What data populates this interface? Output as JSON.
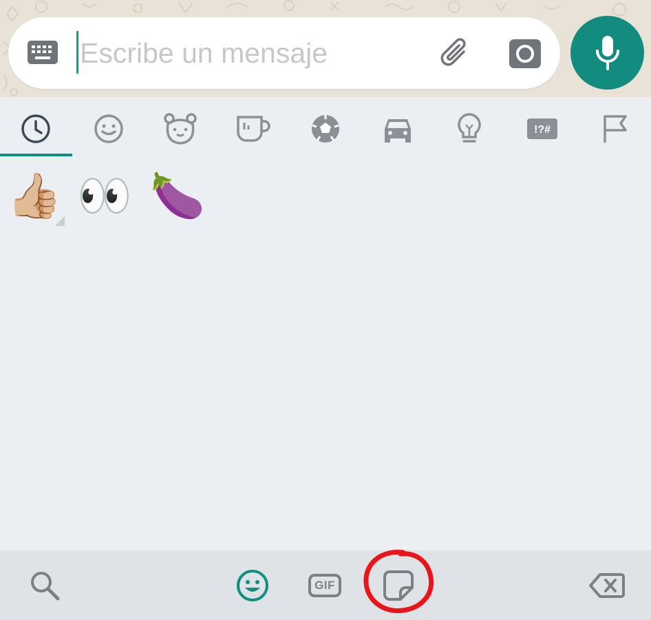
{
  "composer": {
    "placeholder": "Escribe un mensaje",
    "value": "",
    "keyboard_icon": "keyboard-icon",
    "attach_icon": "paperclip-icon",
    "camera_icon": "camera-icon",
    "mic_icon": "microphone-icon"
  },
  "categories": [
    {
      "name": "recent",
      "icon": "clock-icon",
      "selected": true
    },
    {
      "name": "smileys",
      "icon": "smiley-icon",
      "selected": false
    },
    {
      "name": "animals",
      "icon": "bear-icon",
      "selected": false
    },
    {
      "name": "food",
      "icon": "cup-icon",
      "selected": false
    },
    {
      "name": "activities",
      "icon": "soccer-ball-icon",
      "selected": false
    },
    {
      "name": "travel",
      "icon": "car-icon",
      "selected": false
    },
    {
      "name": "objects",
      "icon": "lightbulb-icon",
      "selected": false
    },
    {
      "name": "symbols",
      "icon": "symbols-icon",
      "label": "!?#",
      "selected": false
    },
    {
      "name": "flags",
      "icon": "flag-icon",
      "selected": false
    }
  ],
  "recent_emojis": [
    {
      "char": "👍🏼",
      "name": "thumbs-up",
      "has_variants": true
    },
    {
      "char": "👀",
      "name": "eyes",
      "has_variants": false
    },
    {
      "char": "🍆",
      "name": "eggplant",
      "has_variants": false
    }
  ],
  "bottom_bar": {
    "search_icon": "search-icon",
    "emoji_icon": "smiley-icon",
    "gif_label": "GIF",
    "sticker_icon": "sticker-icon",
    "backspace_icon": "backspace-icon",
    "active_tab": "emoji",
    "highlighted": "sticker"
  },
  "colors": {
    "accent": "#128c7e",
    "accent_teal": "#0f8f84",
    "panel_bg": "#eceff2",
    "bottom_bar_bg": "#e0e3e6",
    "icon_gray": "#7b8084",
    "highlight_red": "#e8151b"
  }
}
